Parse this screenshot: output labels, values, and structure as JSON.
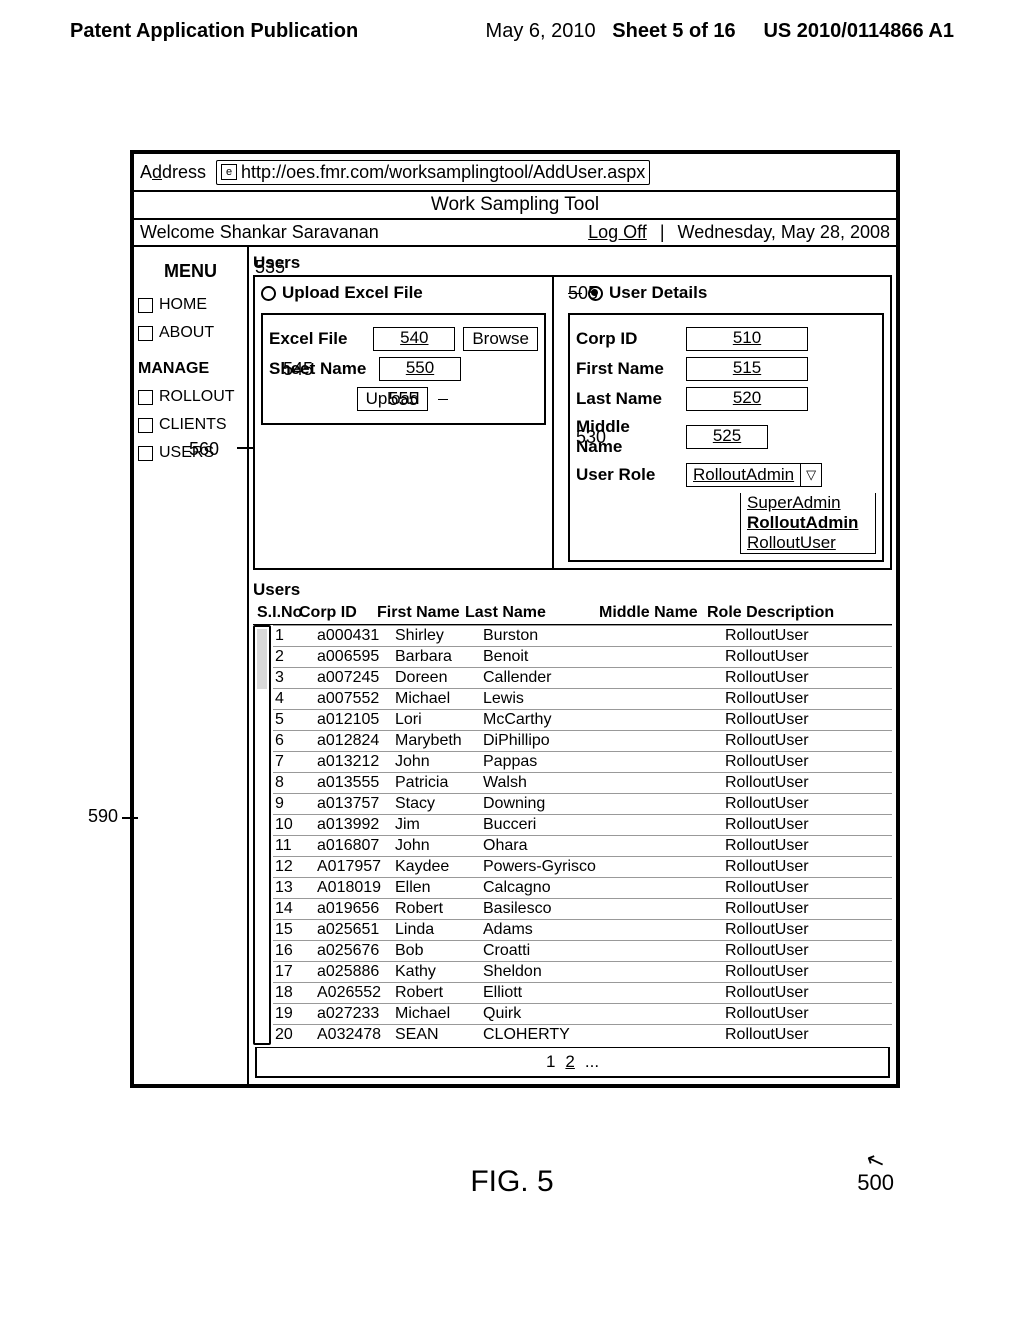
{
  "header": {
    "left": "Patent Application Publication",
    "date": "May 6, 2010",
    "sheet": "Sheet 5 of 16",
    "pubno": "US 2010/0114866 A1"
  },
  "addressbar": {
    "label_pre": "A",
    "label_underline": "d",
    "label_post": "dress",
    "url": "http://oes.fmr.com/worksamplingtool/AddUser.aspx"
  },
  "app": {
    "title": "Work Sampling Tool",
    "welcome": "Welcome Shankar Saravanan",
    "logoff": "Log Off",
    "date": "Wednesday, May 28, 2008"
  },
  "menu": {
    "heading": "MENU",
    "items": [
      "HOME",
      "ABOUT"
    ],
    "manage_heading": "MANAGE",
    "manage_items": [
      "ROLLOUT",
      "CLIENTS",
      "USERS"
    ]
  },
  "users_section_label": "Users",
  "upload": {
    "radio_label": "Upload Excel File",
    "callout": "535",
    "excel_label": "Excel File",
    "excel_callout": "540",
    "browse": "Browse",
    "browse_callout": "545",
    "sheet_label": "Sheet Name",
    "sheet_callout": "550",
    "upload_btn": "Upload",
    "upload_callout": "555",
    "rollout_callout": "560"
  },
  "details": {
    "radio_label": "User Details",
    "radio_callout": "505",
    "corp_label": "Corp ID",
    "corp_callout": "510",
    "first_label": "First Name",
    "first_callout": "515",
    "last_label": "Last Name",
    "last_callout": "520",
    "mid_label": "Middle Name",
    "mid_callout": "525",
    "mid_box_callout": "530",
    "role_label": "User Role",
    "role_value": "RolloutAdmin",
    "role_options": [
      "SuperAdmin",
      "RolloutAdmin",
      "RolloutUser"
    ],
    "role_bold_index": 1
  },
  "table": {
    "heading": "Users",
    "callout_left": "590",
    "cols": [
      "S.I.No",
      "Corp ID",
      "First Name",
      "Last Name",
      "Middle Name",
      "Role Description"
    ],
    "rows": [
      {
        "n": "1",
        "c": "a000431",
        "f": "Shirley",
        "l": "Burston",
        "m": "",
        "r": "RolloutUser"
      },
      {
        "n": "2",
        "c": "a006595",
        "f": "Barbara",
        "l": "Benoit",
        "m": "",
        "r": "RolloutUser"
      },
      {
        "n": "3",
        "c": "a007245",
        "f": "Doreen",
        "l": "Callender",
        "m": "",
        "r": "RolloutUser"
      },
      {
        "n": "4",
        "c": "a007552",
        "f": "Michael",
        "l": "Lewis",
        "m": "",
        "r": "RolloutUser"
      },
      {
        "n": "5",
        "c": "a012105",
        "f": "Lori",
        "l": "McCarthy",
        "m": "",
        "r": "RolloutUser"
      },
      {
        "n": "6",
        "c": "a012824",
        "f": "Marybeth",
        "l": "DiPhillipo",
        "m": "",
        "r": "RolloutUser"
      },
      {
        "n": "7",
        "c": "a013212",
        "f": "John",
        "l": "Pappas",
        "m": "",
        "r": "RolloutUser"
      },
      {
        "n": "8",
        "c": "a013555",
        "f": "Patricia",
        "l": "Walsh",
        "m": "",
        "r": "RolloutUser"
      },
      {
        "n": "9",
        "c": "a013757",
        "f": "Stacy",
        "l": "Downing",
        "m": "",
        "r": "RolloutUser"
      },
      {
        "n": "10",
        "c": "a013992",
        "f": "Jim",
        "l": "Bucceri",
        "m": "",
        "r": "RolloutUser"
      },
      {
        "n": "11",
        "c": "a016807",
        "f": "John",
        "l": "Ohara",
        "m": "",
        "r": "RolloutUser"
      },
      {
        "n": "12",
        "c": "A017957",
        "f": "Kaydee",
        "l": "Powers-Gyrisco",
        "m": "",
        "r": "RolloutUser"
      },
      {
        "n": "13",
        "c": "A018019",
        "f": "Ellen",
        "l": "Calcagno",
        "m": "",
        "r": "RolloutUser"
      },
      {
        "n": "14",
        "c": "a019656",
        "f": "Robert",
        "l": "Basilesco",
        "m": "",
        "r": "RolloutUser"
      },
      {
        "n": "15",
        "c": "a025651",
        "f": "Linda",
        "l": "Adams",
        "m": "",
        "r": "RolloutUser"
      },
      {
        "n": "16",
        "c": "a025676",
        "f": "Bob",
        "l": "Croatti",
        "m": "",
        "r": "RolloutUser"
      },
      {
        "n": "17",
        "c": "a025886",
        "f": "Kathy",
        "l": "Sheldon",
        "m": "",
        "r": "RolloutUser"
      },
      {
        "n": "18",
        "c": "A026552",
        "f": "Robert",
        "l": "Elliott",
        "m": "",
        "r": "RolloutUser"
      },
      {
        "n": "19",
        "c": "a027233",
        "f": "Michael",
        "l": "Quirk",
        "m": "",
        "r": "RolloutUser"
      },
      {
        "n": "20",
        "c": "A032478",
        "f": "SEAN",
        "l": "CLOHERTY",
        "m": "",
        "r": "RolloutUser"
      }
    ],
    "pager": {
      "p1": "1",
      "p2": "2",
      "more": "..."
    }
  },
  "figure": {
    "label": "FIG. 5",
    "num": "500"
  }
}
